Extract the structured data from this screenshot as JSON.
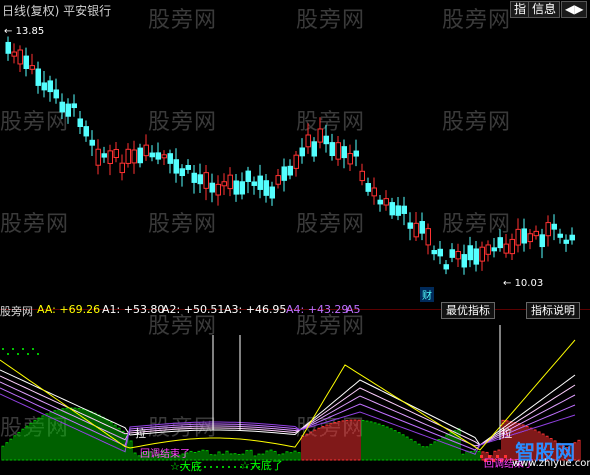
{
  "header": {
    "title": "日线(复权)  平安银行",
    "btn_index": "指",
    "btn_info": "信息",
    "btn_more": "◀▶"
  },
  "price_labels": {
    "high": "13.85",
    "low": "10.03",
    "cai": "财"
  },
  "indicator": {
    "name": "股旁网",
    "aa": "AA: +69.26",
    "a1": "A1: +53.80",
    "a2": "A2: +50.51",
    "a3": "A3: +46.95",
    "a4": "A4: +43.29",
    "a5": "A5",
    "best_btn": "最优指标",
    "desc_btn": "指标说明"
  },
  "annotations": {
    "la1": "拉",
    "la2": "拉",
    "da1": "☆大底",
    "da2": "☆大底了",
    "pink1": "回调结束了",
    "pink2": "回调结束了"
  },
  "watermark": {
    "text": "股旁网",
    "logo": "智股网",
    "url": "www.zhiyue.com"
  },
  "colors": {
    "up": "#ff3232",
    "down": "#54ffff",
    "neutral": "#ffffff",
    "yellow": "#ffff00",
    "green": "#00c000",
    "purple": "#b450ff"
  }
}
